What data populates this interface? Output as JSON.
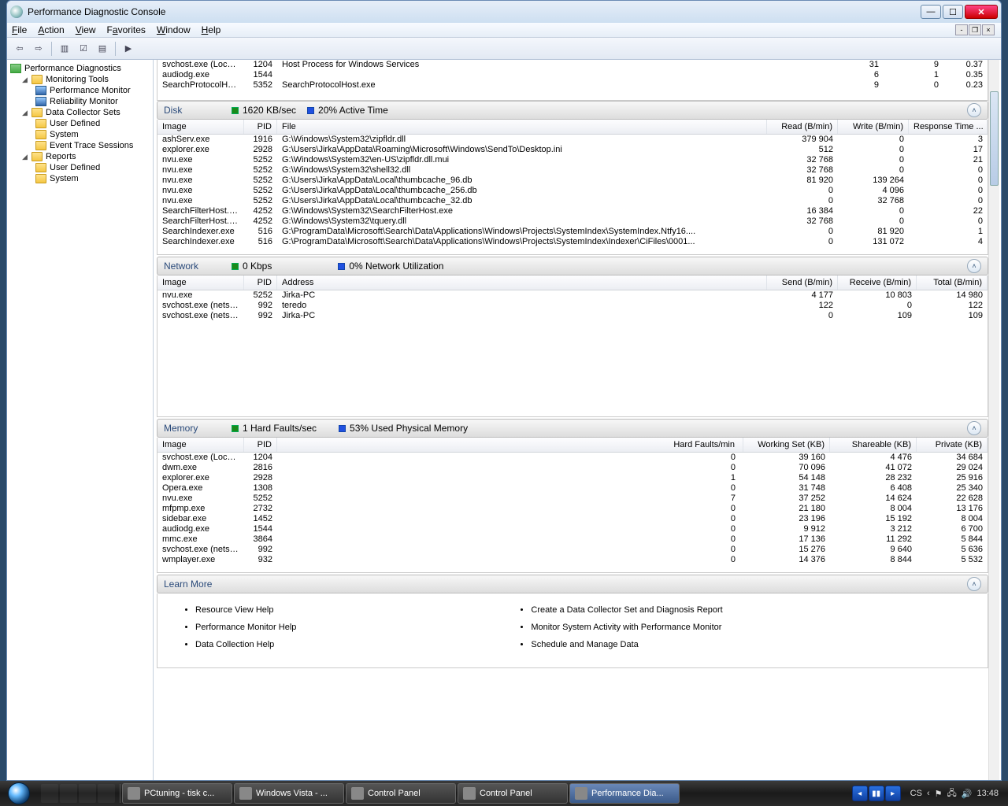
{
  "window": {
    "title": "Performance Diagnostic Console"
  },
  "menu": {
    "file": "File",
    "action": "Action",
    "view": "View",
    "favorites": "Favorites",
    "window": "Window",
    "help": "Help"
  },
  "tree": {
    "root": "Performance Diagnostics",
    "mon": "Monitoring Tools",
    "perfmon": "Performance Monitor",
    "relmon": "Reliability Monitor",
    "dcs": "Data Collector Sets",
    "ud": "User Defined",
    "sys": "System",
    "ets": "Event Trace Sessions",
    "reports": "Reports"
  },
  "top_rows": [
    {
      "img": "svchost.exe (LocalS...",
      "pid": "1204",
      "desc": "Host Process for Windows Services",
      "a": "31",
      "b": "9",
      "c": "0.37"
    },
    {
      "img": "audiodg.exe",
      "pid": "1544",
      "desc": "",
      "a": "6",
      "b": "1",
      "c": "0.35"
    },
    {
      "img": "SearchProtocolHos...",
      "pid": "5352",
      "desc": "SearchProtocolHost.exe",
      "a": "9",
      "b": "0",
      "c": "0.23"
    }
  ],
  "disk": {
    "title": "Disk",
    "stat1": "1620 KB/sec",
    "stat2": "20% Active Time",
    "cols": {
      "img": "Image",
      "pid": "PID",
      "file": "File",
      "read": "Read (B/min)",
      "write": "Write (B/min)",
      "resp": "Response Time ..."
    },
    "rows": [
      {
        "img": "ashServ.exe",
        "pid": "1916",
        "file": "G:\\Windows\\System32\\zipfldr.dll",
        "read": "379 904",
        "write": "0",
        "resp": "3"
      },
      {
        "img": "explorer.exe",
        "pid": "2928",
        "file": "G:\\Users\\Jirka\\AppData\\Roaming\\Microsoft\\Windows\\SendTo\\Desktop.ini",
        "read": "512",
        "write": "0",
        "resp": "17"
      },
      {
        "img": "nvu.exe",
        "pid": "5252",
        "file": "G:\\Windows\\System32\\en-US\\zipfldr.dll.mui",
        "read": "32 768",
        "write": "0",
        "resp": "21"
      },
      {
        "img": "nvu.exe",
        "pid": "5252",
        "file": "G:\\Windows\\System32\\shell32.dll",
        "read": "32 768",
        "write": "0",
        "resp": "0"
      },
      {
        "img": "nvu.exe",
        "pid": "5252",
        "file": "G:\\Users\\Jirka\\AppData\\Local\\thumbcache_96.db",
        "read": "81 920",
        "write": "139 264",
        "resp": "0"
      },
      {
        "img": "nvu.exe",
        "pid": "5252",
        "file": "G:\\Users\\Jirka\\AppData\\Local\\thumbcache_256.db",
        "read": "0",
        "write": "4 096",
        "resp": "0"
      },
      {
        "img": "nvu.exe",
        "pid": "5252",
        "file": "G:\\Users\\Jirka\\AppData\\Local\\thumbcache_32.db",
        "read": "0",
        "write": "32 768",
        "resp": "0"
      },
      {
        "img": "SearchFilterHost.exe",
        "pid": "4252",
        "file": "G:\\Windows\\System32\\SearchFilterHost.exe",
        "read": "16 384",
        "write": "0",
        "resp": "22"
      },
      {
        "img": "SearchFilterHost.exe",
        "pid": "4252",
        "file": "G:\\Windows\\System32\\tquery.dll",
        "read": "32 768",
        "write": "0",
        "resp": "0"
      },
      {
        "img": "SearchIndexer.exe",
        "pid": "516",
        "file": "G:\\ProgramData\\Microsoft\\Search\\Data\\Applications\\Windows\\Projects\\SystemIndex\\SystemIndex.Ntfy16....",
        "read": "0",
        "write": "81 920",
        "resp": "1"
      },
      {
        "img": "SearchIndexer.exe",
        "pid": "516",
        "file": "G:\\ProgramData\\Microsoft\\Search\\Data\\Applications\\Windows\\Projects\\SystemIndex\\Indexer\\CiFiles\\0001...",
        "read": "0",
        "write": "131 072",
        "resp": "4"
      }
    ]
  },
  "net": {
    "title": "Network",
    "stat1": "0 Kbps",
    "stat2": "0% Network Utilization",
    "cols": {
      "img": "Image",
      "pid": "PID",
      "addr": "Address",
      "send": "Send (B/min)",
      "recv": "Receive (B/min)",
      "tot": "Total (B/min)"
    },
    "rows": [
      {
        "img": "nvu.exe",
        "pid": "5252",
        "addr": "Jirka-PC",
        "send": "4 177",
        "recv": "10 803",
        "tot": "14 980"
      },
      {
        "img": "svchost.exe (netsvcs)",
        "pid": "992",
        "addr": "teredo",
        "send": "122",
        "recv": "0",
        "tot": "122"
      },
      {
        "img": "svchost.exe (netsvcs)",
        "pid": "992",
        "addr": "Jirka-PC",
        "send": "0",
        "recv": "109",
        "tot": "109"
      }
    ]
  },
  "mem": {
    "title": "Memory",
    "stat1": "1 Hard Faults/sec",
    "stat2": "53% Used Physical Memory",
    "cols": {
      "img": "Image",
      "pid": "PID",
      "hf": "Hard Faults/min",
      "ws": "Working Set (KB)",
      "sh": "Shareable (KB)",
      "pr": "Private (KB)"
    },
    "rows": [
      {
        "img": "svchost.exe (LocalS...",
        "pid": "1204",
        "hf": "0",
        "ws": "39 160",
        "sh": "4 476",
        "pr": "34 684"
      },
      {
        "img": "dwm.exe",
        "pid": "2816",
        "hf": "0",
        "ws": "70 096",
        "sh": "41 072",
        "pr": "29 024"
      },
      {
        "img": "explorer.exe",
        "pid": "2928",
        "hf": "1",
        "ws": "54 148",
        "sh": "28 232",
        "pr": "25 916"
      },
      {
        "img": "Opera.exe",
        "pid": "1308",
        "hf": "0",
        "ws": "31 748",
        "sh": "6 408",
        "pr": "25 340"
      },
      {
        "img": "nvu.exe",
        "pid": "5252",
        "hf": "7",
        "ws": "37 252",
        "sh": "14 624",
        "pr": "22 628"
      },
      {
        "img": "mfpmp.exe",
        "pid": "2732",
        "hf": "0",
        "ws": "21 180",
        "sh": "8 004",
        "pr": "13 176"
      },
      {
        "img": "sidebar.exe",
        "pid": "1452",
        "hf": "0",
        "ws": "23 196",
        "sh": "15 192",
        "pr": "8 004"
      },
      {
        "img": "audiodg.exe",
        "pid": "1544",
        "hf": "0",
        "ws": "9 912",
        "sh": "3 212",
        "pr": "6 700"
      },
      {
        "img": "mmc.exe",
        "pid": "3864",
        "hf": "0",
        "ws": "17 136",
        "sh": "11 292",
        "pr": "5 844"
      },
      {
        "img": "svchost.exe (netsvcs)",
        "pid": "992",
        "hf": "0",
        "ws": "15 276",
        "sh": "9 640",
        "pr": "5 636"
      },
      {
        "img": "wmplayer.exe",
        "pid": "932",
        "hf": "0",
        "ws": "14 376",
        "sh": "8 844",
        "pr": "5 532"
      }
    ]
  },
  "learn": {
    "title": "Learn More",
    "left": [
      "Resource View Help",
      "Performance Monitor Help",
      "Data Collection Help"
    ],
    "right": [
      "Create a Data Collector Set and Diagnosis Report",
      "Monitor System Activity with Performance Monitor",
      "Schedule and Manage Data"
    ]
  },
  "taskbar": {
    "btns": [
      {
        "label": "PCtuning - tisk c..."
      },
      {
        "label": "Windows Vista - ..."
      },
      {
        "label": "Control Panel"
      },
      {
        "label": "Control Panel"
      },
      {
        "label": "Performance Dia...",
        "active": true
      }
    ],
    "lang": "CS",
    "clock": "13:48"
  }
}
